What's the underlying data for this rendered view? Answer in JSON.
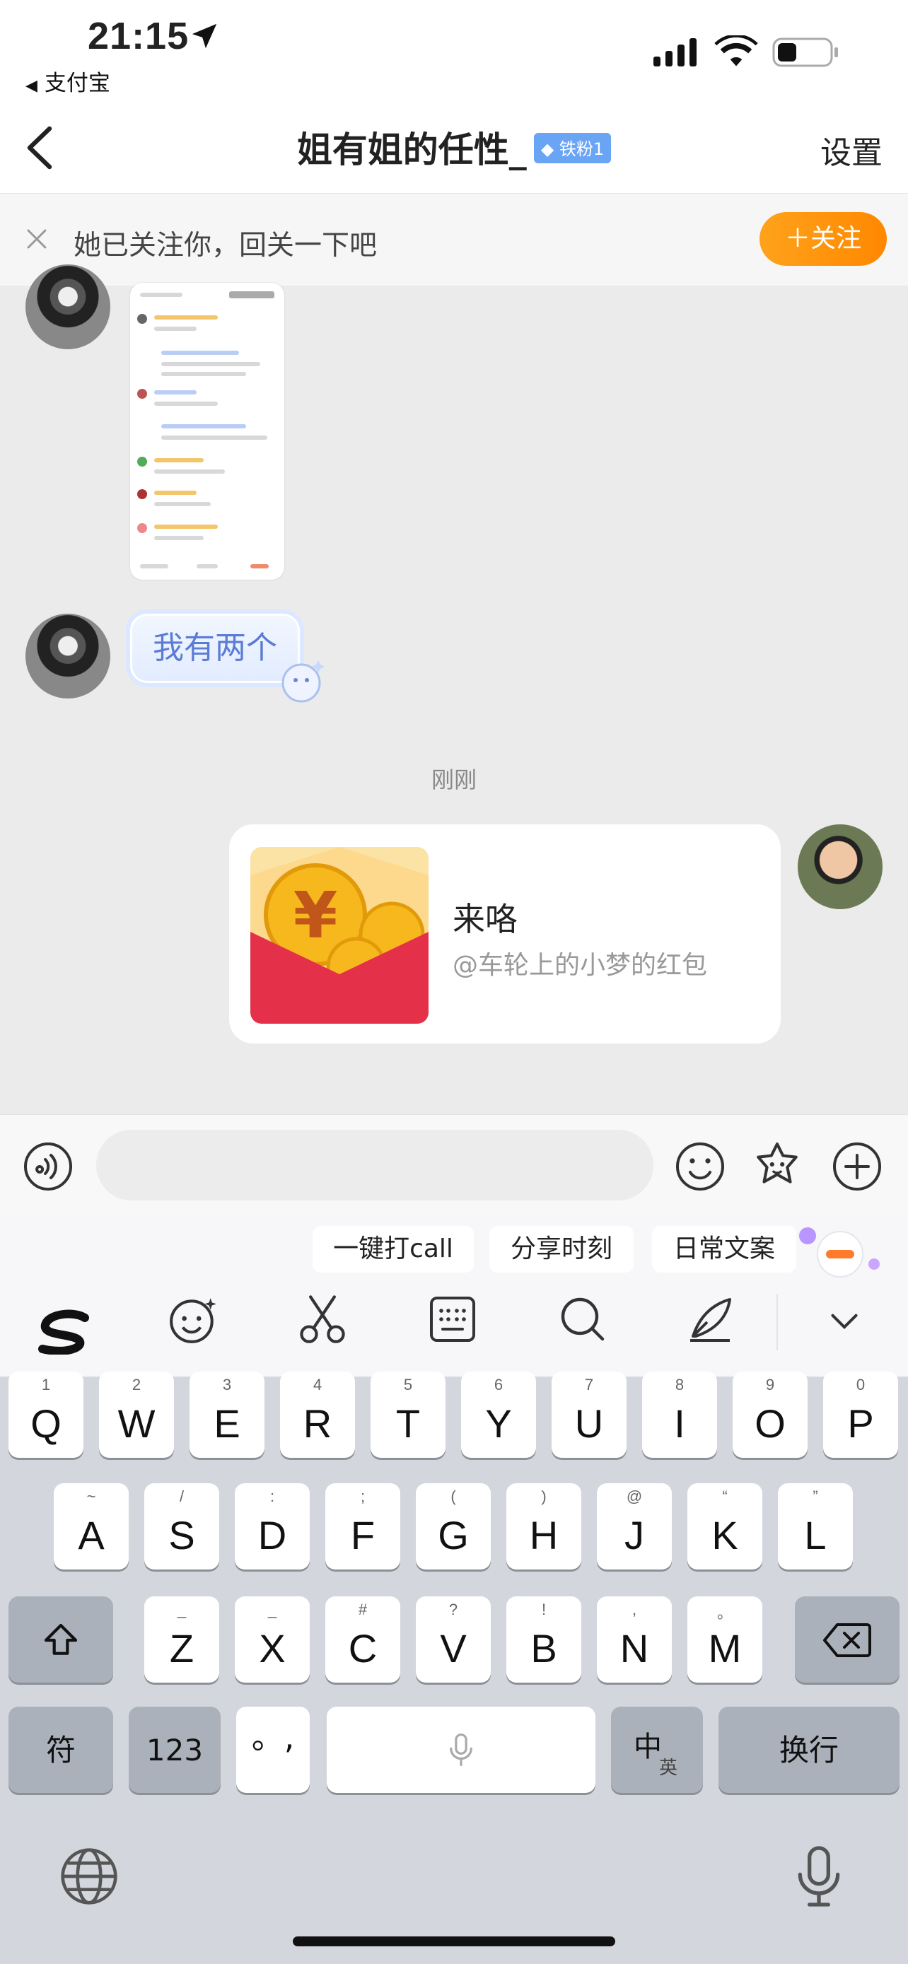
{
  "status_bar": {
    "time": "21:15",
    "back_app": "支付宝"
  },
  "nav": {
    "title": "姐有姐的任性_",
    "badge": "铁粉1",
    "settings": "设置"
  },
  "follow_banner": {
    "text": "她已关注你，回关一下吧",
    "button": "＋关注"
  },
  "messages": {
    "bubble_text": "我有两个",
    "time_label": "刚刚",
    "red_packet": {
      "title": "来咯",
      "subtitle": "@车轮上的小梦的红包"
    }
  },
  "keyboard": {
    "chips": [
      "一键打call",
      "分享时刻",
      "日常文案"
    ],
    "row1": [
      {
        "k": "Q",
        "s": "1"
      },
      {
        "k": "W",
        "s": "2"
      },
      {
        "k": "E",
        "s": "3"
      },
      {
        "k": "R",
        "s": "4"
      },
      {
        "k": "T",
        "s": "5"
      },
      {
        "k": "Y",
        "s": "6"
      },
      {
        "k": "U",
        "s": "7"
      },
      {
        "k": "I",
        "s": "8"
      },
      {
        "k": "O",
        "s": "9"
      },
      {
        "k": "P",
        "s": "0"
      }
    ],
    "row2": [
      {
        "k": "A",
        "s": "~"
      },
      {
        "k": "S",
        "s": "/"
      },
      {
        "k": "D",
        "s": ":"
      },
      {
        "k": "F",
        "s": ";"
      },
      {
        "k": "G",
        "s": "("
      },
      {
        "k": "H",
        "s": ")"
      },
      {
        "k": "J",
        "s": "@"
      },
      {
        "k": "K",
        "s": "“"
      },
      {
        "k": "L",
        "s": "”"
      }
    ],
    "row3": [
      {
        "k": "Z",
        "s": "_"
      },
      {
        "k": "X",
        "s": "_"
      },
      {
        "k": "C",
        "s": "#"
      },
      {
        "k": "V",
        "s": "?"
      },
      {
        "k": "B",
        "s": "!"
      },
      {
        "k": "N",
        "s": ","
      },
      {
        "k": "M",
        "s": "。"
      }
    ],
    "symbols": "符",
    "numbers": "123",
    "punct": "。,",
    "lang": "中",
    "lang_sub": "英",
    "enter": "换行"
  },
  "colors": {
    "follow_accent": "#ff8c00",
    "badge_blue": "#6aa5f5",
    "red_packet": "#e5304a"
  }
}
